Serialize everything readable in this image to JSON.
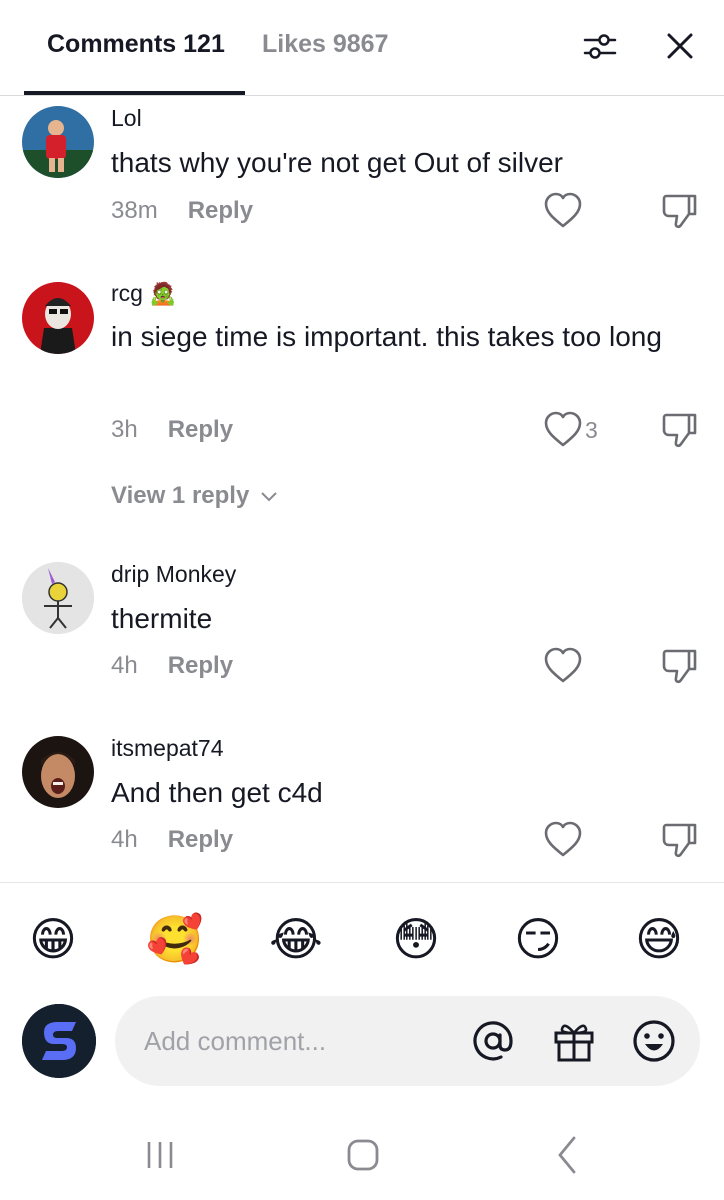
{
  "tabs": {
    "comments_label": "Comments 121",
    "likes_label": "Likes 9867"
  },
  "comments": [
    {
      "username": "Lol",
      "text": "thats why you're not get Out of silver",
      "time": "38m",
      "reply_label": "Reply",
      "likes": ""
    },
    {
      "username": "rcg",
      "username_emoji": "🧟",
      "text": "in siege time is important. this takes too long",
      "time": "3h",
      "reply_label": "Reply",
      "likes": "3",
      "view_replies": "View 1 reply"
    },
    {
      "username": "drip Monkey",
      "text": "thermite",
      "time": "4h",
      "reply_label": "Reply",
      "likes": ""
    },
    {
      "username": "itsmepat74",
      "text": "And then get c4d",
      "time": "4h",
      "reply_label": "Reply",
      "likes": ""
    }
  ],
  "emoji_bar": [
    "😁",
    "🥰",
    "😂",
    "😳",
    "😏",
    "😅"
  ],
  "composer": {
    "placeholder": "Add comment..."
  },
  "icons": [
    "filter-icon",
    "close-icon",
    "heart-icon",
    "dislike-icon",
    "chevron-down-icon",
    "mention-icon",
    "gift-icon",
    "emoji-icon",
    "recent-apps-icon",
    "home-icon",
    "back-icon"
  ],
  "colors": {
    "primary_text": "#161823",
    "secondary_text": "#8a8b91",
    "input_bg": "#f1f1f2"
  }
}
